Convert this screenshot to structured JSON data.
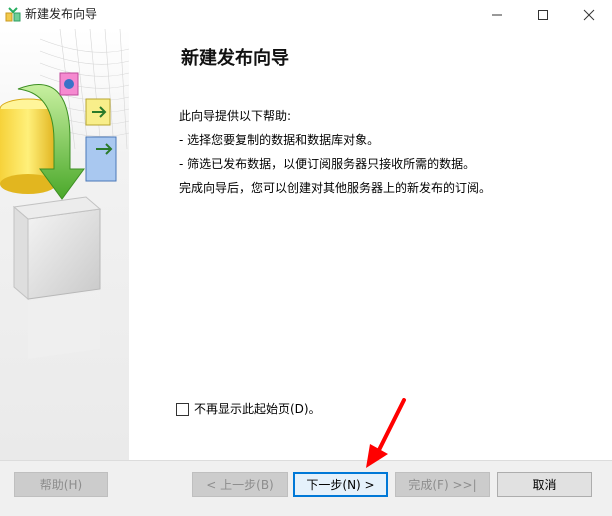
{
  "window": {
    "title": "新建发布向导"
  },
  "content": {
    "heading": "新建发布向导",
    "lines": [
      "此向导提供以下帮助:",
      "- 选择您要复制的数据和数据库对象。",
      "- 筛选已发布数据，以便订阅服务器只接收所需的数据。",
      "完成向导后，您可以创建对其他服务器上的新发布的订阅。"
    ],
    "dont_show_label": "不再显示此起始页(D)。",
    "dont_show_checked": false
  },
  "buttons": {
    "help": "帮助(H)",
    "prev": "< 上一步(B)",
    "next": "下一步(N) >",
    "finish": "完成(F) >>|",
    "cancel": "取消"
  },
  "colors": {
    "focus_border": "#0078d7",
    "annotation_arrow": "#ff0000"
  },
  "icons": [
    "app-icon",
    "minimize-icon",
    "maximize-icon",
    "close-icon",
    "wizard-illustration",
    "red-arrow-annotation"
  ]
}
